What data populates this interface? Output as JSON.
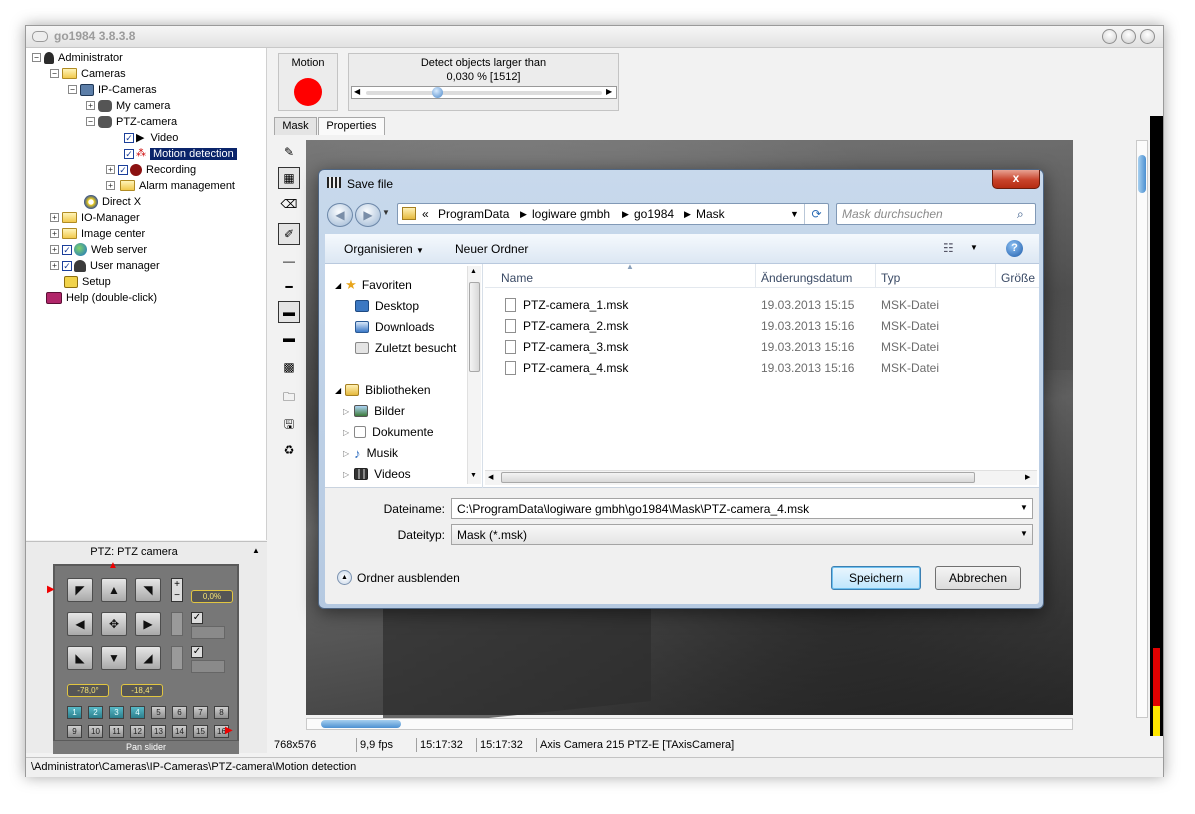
{
  "app": {
    "title": "go1984 3.8.3.8"
  },
  "tree": {
    "items": [
      {
        "label": "Administrator",
        "sign": "−"
      },
      {
        "label": "Cameras",
        "sign": "−"
      },
      {
        "label": "IP-Cameras",
        "sign": "−"
      },
      {
        "label": "My camera",
        "sign": "+"
      },
      {
        "label": "PTZ-camera",
        "sign": "−"
      },
      {
        "label": "Video"
      },
      {
        "label": "Motion detection"
      },
      {
        "label": "Recording",
        "sign": "+"
      },
      {
        "label": "Alarm management",
        "sign": "+"
      },
      {
        "label": "Direct X"
      },
      {
        "label": "IO-Manager",
        "sign": "+"
      },
      {
        "label": "Image center",
        "sign": "+"
      },
      {
        "label": "Web server",
        "sign": "+"
      },
      {
        "label": "User manager",
        "sign": "+"
      },
      {
        "label": "Setup"
      },
      {
        "label": "Help (double-click)"
      }
    ]
  },
  "motion": {
    "label": "Motion",
    "detect_label": "Detect objects larger than",
    "detect_value": "0,030 % [1512]",
    "slider_fraction": 0.3,
    "indicator_color": "#ff0000"
  },
  "tabs": [
    {
      "label": "Mask",
      "active": true
    },
    {
      "label": "Properties",
      "active": false
    }
  ],
  "ptz": {
    "title": "PTZ: PTZ camera",
    "zoom_value": "0,0%",
    "pan_value": "-78,0°",
    "tilt_value": "-18,4°",
    "presets": [
      "1",
      "2",
      "3",
      "4",
      "5",
      "6",
      "7",
      "8",
      "9",
      "10",
      "11",
      "12",
      "13",
      "14",
      "15",
      "16"
    ],
    "active_presets": [
      "1",
      "2",
      "3",
      "4"
    ],
    "pan_slider_label": "Pan slider"
  },
  "info": {
    "resolution": "768x576",
    "fps": "9,9 fps",
    "time1": "15:17:32",
    "time2": "15:17:32",
    "camera": "Axis Camera 215 PTZ-E [TAxisCamera]"
  },
  "status": {
    "path": "\\Administrator\\Cameras\\IP-Cameras\\PTZ-camera\\Motion detection"
  },
  "dialog": {
    "title": "Save file",
    "close_label": "x",
    "breadcrumb": [
      "ProgramData",
      "logiware gmbh",
      "go1984",
      "Mask"
    ],
    "breadcrumb_prefix": "«",
    "search_placeholder": "Mask durchsuchen",
    "organize_label": "Organisieren",
    "new_folder_label": "Neuer Ordner",
    "help_label": "?",
    "nav": {
      "favorites_label": "Favoriten",
      "favorites": [
        "Desktop",
        "Downloads",
        "Zuletzt besucht"
      ],
      "libraries_label": "Bibliotheken",
      "libraries": [
        "Bilder",
        "Dokumente",
        "Musik",
        "Videos"
      ]
    },
    "columns": [
      "Name",
      "Änderungsdatum",
      "Typ",
      "Größe"
    ],
    "files": [
      {
        "name": "PTZ-camera_1.msk",
        "date": "19.03.2013 15:15",
        "type": "MSK-Datei"
      },
      {
        "name": "PTZ-camera_2.msk",
        "date": "19.03.2013 15:16",
        "type": "MSK-Datei"
      },
      {
        "name": "PTZ-camera_3.msk",
        "date": "19.03.2013 15:16",
        "type": "MSK-Datei"
      },
      {
        "name": "PTZ-camera_4.msk",
        "date": "19.03.2013 15:16",
        "type": "MSK-Datei"
      }
    ],
    "filename_label": "Dateiname:",
    "filename_value": "C:\\ProgramData\\logiware gmbh\\go1984\\Mask\\PTZ-camera_4.msk",
    "filetype_label": "Dateityp:",
    "filetype_value": "Mask (*.msk)",
    "hide_folders_label": "Ordner ausblenden",
    "save_label": "Speichern",
    "cancel_label": "Abbrechen"
  },
  "colors": {
    "selection": "#0a246a",
    "dialog_frame": "#b5c9e1",
    "close_red": "#c8432b"
  }
}
